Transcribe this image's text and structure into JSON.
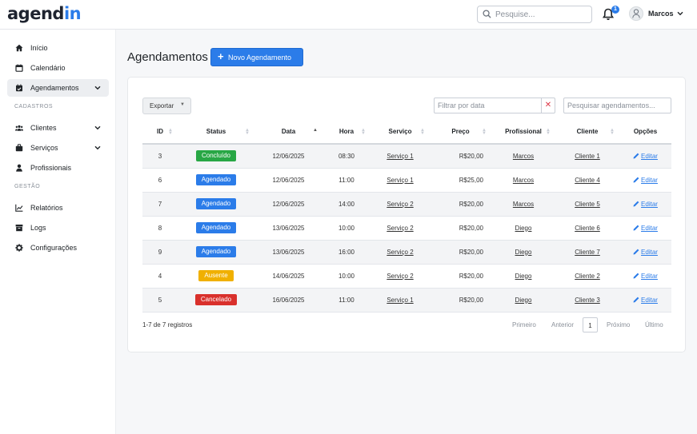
{
  "app": {
    "logo_main": "agend",
    "logo_accent": "in"
  },
  "header": {
    "search_placeholder": "Pesquise...",
    "notifications_count": "1",
    "user_name": "Marcos"
  },
  "sidebar": {
    "items": [
      {
        "label": "Início",
        "icon": "home-icon"
      },
      {
        "label": "Calendário",
        "icon": "calendar-icon"
      },
      {
        "label": "Agendamentos",
        "icon": "calendar-check-icon",
        "active": true,
        "expandable": true
      }
    ],
    "section_cadastros": "CADASTROS",
    "cadastros_items": [
      {
        "label": "Clientes",
        "icon": "users-icon",
        "expandable": true
      },
      {
        "label": "Serviços",
        "icon": "briefcase-icon",
        "expandable": true
      },
      {
        "label": "Profissionais",
        "icon": "user-icon"
      }
    ],
    "section_gestao": "GESTÃO",
    "gestao_items": [
      {
        "label": "Relatórios",
        "icon": "chart-line-icon"
      },
      {
        "label": "Logs",
        "icon": "archive-icon"
      },
      {
        "label": "Configurações",
        "icon": "gear-icon"
      }
    ]
  },
  "main": {
    "title": "Agendamentos",
    "new_button": "Novo Agendamento",
    "export_button": "Exportar",
    "date_filter_placeholder": "Filtrar por data",
    "table_search_placeholder": "Pesquisar agendamentos...",
    "columns": [
      "ID",
      "Status",
      "Data",
      "Hora",
      "Serviço",
      "Preço",
      "Profissional",
      "Cliente",
      "Opções"
    ],
    "rows": [
      {
        "id": "3",
        "status": "Concluído",
        "status_color": "#28a745",
        "date": "12/06/2025",
        "time": "08:30",
        "service": "Serviço 1",
        "price": "R$20,00",
        "professional": "Marcos",
        "client": "Cliente 1",
        "action": "Editar"
      },
      {
        "id": "6",
        "status": "Agendado",
        "status_color": "#2b7ce9",
        "date": "12/06/2025",
        "time": "11:00",
        "service": "Serviço 1",
        "price": "R$25,00",
        "professional": "Marcos",
        "client": "Cliente 4",
        "action": "Editar"
      },
      {
        "id": "7",
        "status": "Agendado",
        "status_color": "#2b7ce9",
        "date": "12/06/2025",
        "time": "14:00",
        "service": "Serviço 2",
        "price": "R$20,00",
        "professional": "Marcos",
        "client": "Cliente 5",
        "action": "Editar"
      },
      {
        "id": "8",
        "status": "Agendado",
        "status_color": "#2b7ce9",
        "date": "13/06/2025",
        "time": "10:00",
        "service": "Serviço 2",
        "price": "R$20,00",
        "professional": "Diego",
        "client": "Cliente 6",
        "action": "Editar"
      },
      {
        "id": "9",
        "status": "Agendado",
        "status_color": "#2b7ce9",
        "date": "13/06/2025",
        "time": "16:00",
        "service": "Serviço 2",
        "price": "R$20,00",
        "professional": "Diego",
        "client": "Cliente 7",
        "action": "Editar"
      },
      {
        "id": "4",
        "status": "Ausente",
        "status_color": "#f0b000",
        "date": "14/06/2025",
        "time": "10:00",
        "service": "Serviço 2",
        "price": "R$20,00",
        "professional": "Diego",
        "client": "Cliente 2",
        "action": "Editar"
      },
      {
        "id": "5",
        "status": "Cancelado",
        "status_color": "#d9302c",
        "date": "16/06/2025",
        "time": "11:00",
        "service": "Serviço 1",
        "price": "R$20,00",
        "professional": "Diego",
        "client": "Cliente 3",
        "action": "Editar"
      }
    ],
    "records_info": "1-7 de 7 registros",
    "pagination": {
      "first": "Primeiro",
      "prev": "Anterior",
      "current": "1",
      "next": "Próximo",
      "last": "Último"
    }
  },
  "colors": {
    "accent": "#2b7ce9",
    "danger": "#dc3545"
  }
}
